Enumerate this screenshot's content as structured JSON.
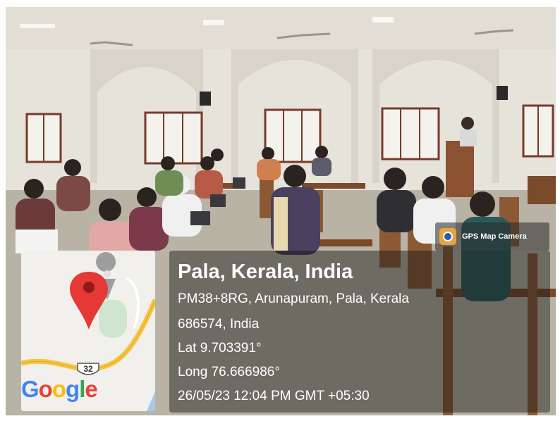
{
  "photo": {
    "description_icons": [
      "classroom-photo"
    ]
  },
  "badge": {
    "label": "GPS Map Camera",
    "icon": "gps-map-camera-icon"
  },
  "location": {
    "title": "Pala, Kerala, India",
    "address_line1": "PM38+8RG, Arunapuram, Pala, Kerala",
    "address_line2": "686574, India",
    "latitude": "Lat 9.703391°",
    "longitude": "Long 76.666986°",
    "timestamp": "26/05/23 12:04 PM GMT +05:30"
  },
  "map": {
    "route_shield": "32",
    "brand": [
      "G",
      "o",
      "o",
      "g",
      "l",
      "e"
    ],
    "pin_color": "#e53935",
    "road_color": "#f5c542"
  }
}
